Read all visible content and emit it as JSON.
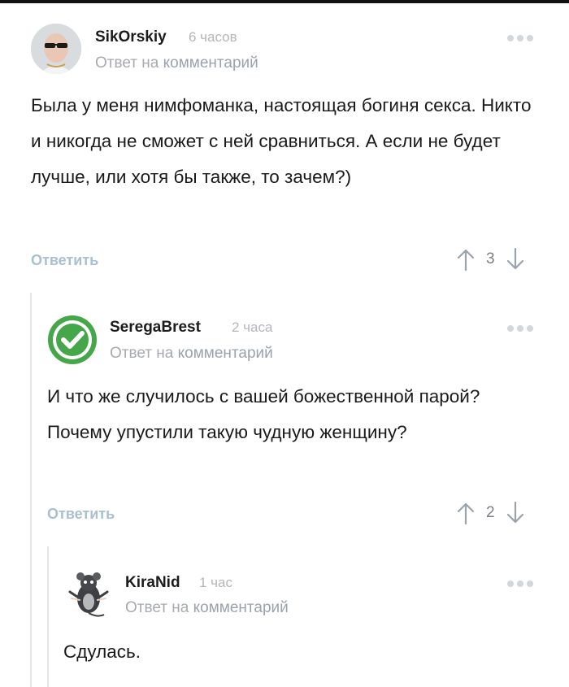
{
  "comments": [
    {
      "author": "SikOrskiy",
      "time": "6 часов",
      "reply_prefix": "Ответ на",
      "reply_target": "комментарий",
      "text": "Была у меня нимфоманка, настоящая богиня секса. Никто и никогда не сможет с ней сравниться. А если не будет лучше, или хотя бы также, то зачем?)",
      "reply_label": "Ответить",
      "score": "3"
    },
    {
      "author": "SeregaBrest",
      "time": "2 часа",
      "reply_prefix": "Ответ на",
      "reply_target": "комментарий",
      "text": "И что же случилось с вашей божественной парой? Почему упустили такую чудную женщину?",
      "reply_label": "Ответить",
      "score": "2"
    },
    {
      "author": "KiraNid",
      "time": "1 час",
      "reply_prefix": "Ответ на",
      "reply_target": "комментарий",
      "text": "Сдулась."
    }
  ],
  "colors": {
    "accent_link": "#a9c0cf",
    "thread_line": "#e3e6ea",
    "check_green": "#46a64a"
  },
  "icons": [
    "more-icon",
    "arrow-up-icon",
    "arrow-down-icon",
    "check-icon",
    "rat-icon"
  ]
}
